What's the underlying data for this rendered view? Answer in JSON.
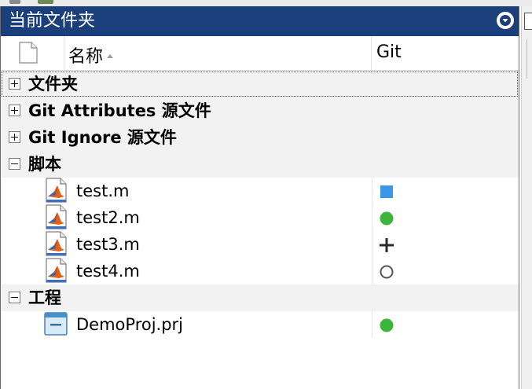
{
  "panel": {
    "title": "当前文件夹"
  },
  "columns": {
    "name": "名称",
    "git": "Git"
  },
  "groups": [
    {
      "label": "文件夹",
      "expanded": false
    },
    {
      "label": "Git Attributes 源文件",
      "expanded": false
    },
    {
      "label": "Git Ignore 源文件",
      "expanded": false
    },
    {
      "label": "脚本",
      "expanded": true
    },
    {
      "label": "工程",
      "expanded": true
    }
  ],
  "scripts": [
    {
      "name": "test.m",
      "git_status": "modified-square",
      "status_color": "#3a98e8"
    },
    {
      "name": "test2.m",
      "git_status": "committed-dot",
      "status_color": "#3cb63a"
    },
    {
      "name": "test3.m",
      "git_status": "added-plus",
      "status_color": "#2b2b2b"
    },
    {
      "name": "test4.m",
      "git_status": "untracked-circle",
      "status_color": "#555555"
    }
  ],
  "projects": [
    {
      "name": "DemoProj.prj",
      "git_status": "committed-dot",
      "status_color": "#3cb63a"
    }
  ],
  "colors": {
    "titlebar": "#1a3f7a",
    "group_row": "#f2f2f2"
  }
}
